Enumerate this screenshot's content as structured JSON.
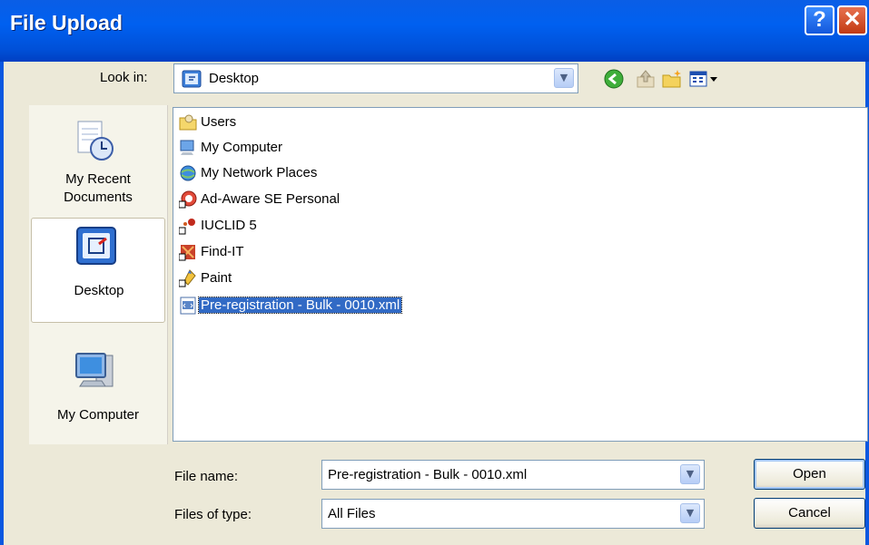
{
  "window": {
    "title": "File Upload"
  },
  "titlebar_buttons": {
    "help": "?",
    "close": "✕"
  },
  "lookin": {
    "label": "Look in:",
    "value": "Desktop"
  },
  "toolbar": {
    "icons": [
      "back-icon",
      "up-folder-icon",
      "new-folder-icon",
      "views-menu-icon"
    ]
  },
  "places": [
    {
      "label_line1": "My Recent",
      "label_line2": "Documents",
      "icon": "recent-documents-icon"
    },
    {
      "label_line1": "Desktop",
      "label_line2": "",
      "icon": "desktop-icon"
    },
    {
      "label_line1": "My Computer",
      "label_line2": "",
      "icon": "my-computer-icon"
    }
  ],
  "files": [
    {
      "name": "Users",
      "icon": "folder-icon"
    },
    {
      "name": "My Computer",
      "icon": "my-computer-icon"
    },
    {
      "name": "My Network Places",
      "icon": "network-places-icon"
    },
    {
      "name": "Ad-Aware SE Personal",
      "icon": "ad-aware-shortcut-icon"
    },
    {
      "name": "IUCLID 5",
      "icon": "iuclid-shortcut-icon"
    },
    {
      "name": "Find-IT",
      "icon": "find-it-shortcut-icon"
    },
    {
      "name": "Paint",
      "icon": "paint-shortcut-icon"
    },
    {
      "name": "Pre-registration - Bulk - 0010.xml",
      "icon": "xml-file-icon",
      "selected": true
    }
  ],
  "filename": {
    "label": "File name:",
    "value": "Pre-registration - Bulk - 0010.xml"
  },
  "filetype": {
    "label": "Files of type:",
    "value": "All Files"
  },
  "buttons": {
    "open": "Open",
    "cancel": "Cancel"
  },
  "colors": {
    "titlebar": "#0058e6",
    "selection": "#316ac5",
    "dialog_bg": "#ece9d8"
  }
}
